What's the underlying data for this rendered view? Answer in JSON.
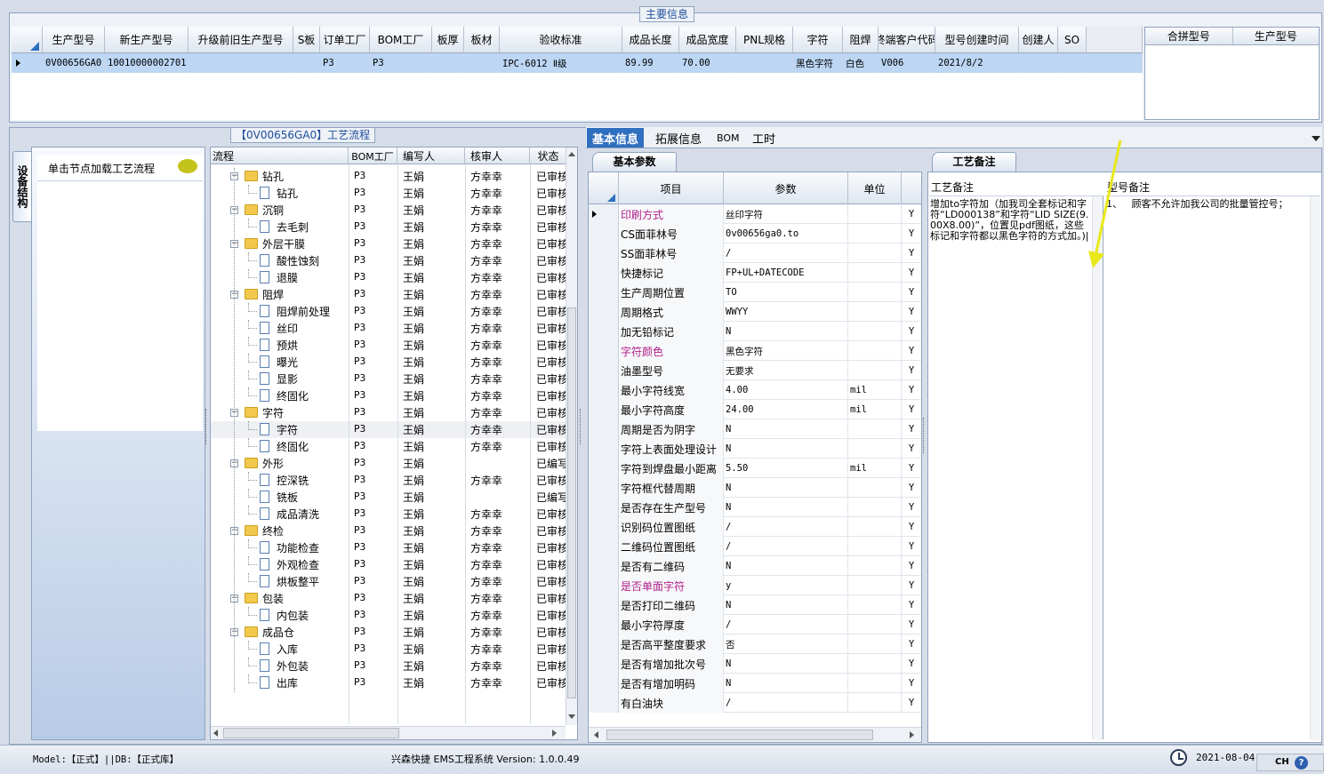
{
  "main_info": {
    "title": "主要信息",
    "columns": [
      "生产型号",
      "新生产型号",
      "升级前旧生产型号",
      "S板",
      "订单工厂",
      "BOM工厂",
      "板厚",
      "板材",
      "验收标准",
      "成品长度",
      "成品宽度",
      "PNL规格",
      "字符",
      "阻焊",
      "终端客户代码",
      "型号创建时间",
      "创建人",
      "SO"
    ],
    "row": [
      "0V00656GA0",
      "10010000002701",
      "",
      "",
      "P3",
      "P3",
      "",
      "",
      "IPC-6012 Ⅱ级",
      "89.99",
      "70.00",
      "",
      "黑色字符",
      "白色",
      "V006",
      "2021/8/2",
      "",
      ""
    ],
    "side_columns": [
      "合拼型号",
      "生产型号"
    ]
  },
  "left_panel": {
    "vertical_tab": "设备结构",
    "hint": "单击节点加载工艺流程"
  },
  "flow": {
    "title": "【0V00656GA0】工艺流程",
    "columns": [
      "流程",
      "BOM工厂",
      "编写人",
      "核审人",
      "状态"
    ],
    "rows": [
      {
        "name": "钻孔",
        "type": "folder",
        "level": 0,
        "bom": "P3",
        "writer": "王娟",
        "reviewer": "方幸幸",
        "status": "已审核"
      },
      {
        "name": "钻孔",
        "type": "doc",
        "level": 1,
        "bom": "P3",
        "writer": "王娟",
        "reviewer": "方幸幸",
        "status": "已审核"
      },
      {
        "name": "沉铜",
        "type": "folder",
        "level": 0,
        "bom": "P3",
        "writer": "王娟",
        "reviewer": "方幸幸",
        "status": "已审核"
      },
      {
        "name": "去毛刺",
        "type": "doc",
        "level": 1,
        "bom": "P3",
        "writer": "王娟",
        "reviewer": "方幸幸",
        "status": "已审核"
      },
      {
        "name": "外层干膜",
        "type": "folder",
        "level": 0,
        "bom": "P3",
        "writer": "王娟",
        "reviewer": "方幸幸",
        "status": "已审核"
      },
      {
        "name": "酸性蚀刻",
        "type": "doc",
        "level": 1,
        "bom": "P3",
        "writer": "王娟",
        "reviewer": "方幸幸",
        "status": "已审核"
      },
      {
        "name": "退膜",
        "type": "doc",
        "level": 1,
        "bom": "P3",
        "writer": "王娟",
        "reviewer": "方幸幸",
        "status": "已审核"
      },
      {
        "name": "阻焊",
        "type": "folder",
        "level": 0,
        "bom": "P3",
        "writer": "王娟",
        "reviewer": "方幸幸",
        "status": "已审核"
      },
      {
        "name": "阻焊前处理",
        "type": "doc",
        "level": 1,
        "bom": "P3",
        "writer": "王娟",
        "reviewer": "方幸幸",
        "status": "已审核"
      },
      {
        "name": "丝印",
        "type": "doc",
        "level": 1,
        "bom": "P3",
        "writer": "王娟",
        "reviewer": "方幸幸",
        "status": "已审核"
      },
      {
        "name": "预烘",
        "type": "doc",
        "level": 1,
        "bom": "P3",
        "writer": "王娟",
        "reviewer": "方幸幸",
        "status": "已审核"
      },
      {
        "name": "曝光",
        "type": "doc",
        "level": 1,
        "bom": "P3",
        "writer": "王娟",
        "reviewer": "方幸幸",
        "status": "已审核"
      },
      {
        "name": "显影",
        "type": "doc",
        "level": 1,
        "bom": "P3",
        "writer": "王娟",
        "reviewer": "方幸幸",
        "status": "已审核"
      },
      {
        "name": "终固化",
        "type": "doc",
        "level": 1,
        "bom": "P3",
        "writer": "王娟",
        "reviewer": "方幸幸",
        "status": "已审核"
      },
      {
        "name": "字符",
        "type": "folder",
        "level": 0,
        "bom": "P3",
        "writer": "王娟",
        "reviewer": "方幸幸",
        "status": "已审核"
      },
      {
        "name": "字符",
        "type": "doc",
        "level": 1,
        "bom": "P3",
        "writer": "王娟",
        "reviewer": "方幸幸",
        "status": "已审核",
        "selected": true
      },
      {
        "name": "终固化",
        "type": "doc",
        "level": 1,
        "bom": "P3",
        "writer": "王娟",
        "reviewer": "方幸幸",
        "status": "已审核"
      },
      {
        "name": "外形",
        "type": "folder",
        "level": 0,
        "bom": "P3",
        "writer": "王娟",
        "reviewer": "",
        "status": "已编写"
      },
      {
        "name": "控深铣",
        "type": "doc",
        "level": 1,
        "bom": "P3",
        "writer": "王娟",
        "reviewer": "方幸幸",
        "status": "已审核"
      },
      {
        "name": "铣板",
        "type": "doc",
        "level": 1,
        "bom": "P3",
        "writer": "王娟",
        "reviewer": "",
        "status": "已编写"
      },
      {
        "name": "成品清洗",
        "type": "doc",
        "level": 1,
        "bom": "P3",
        "writer": "王娟",
        "reviewer": "方幸幸",
        "status": "已审核"
      },
      {
        "name": "终检",
        "type": "folder",
        "level": 0,
        "bom": "P3",
        "writer": "王娟",
        "reviewer": "方幸幸",
        "status": "已审核"
      },
      {
        "name": "功能检查",
        "type": "doc",
        "level": 1,
        "bom": "P3",
        "writer": "王娟",
        "reviewer": "方幸幸",
        "status": "已审核"
      },
      {
        "name": "外观检查",
        "type": "doc",
        "level": 1,
        "bom": "P3",
        "writer": "王娟",
        "reviewer": "方幸幸",
        "status": "已审核"
      },
      {
        "name": "烘板整平",
        "type": "doc",
        "level": 1,
        "bom": "P3",
        "writer": "王娟",
        "reviewer": "方幸幸",
        "status": "已审核"
      },
      {
        "name": "包装",
        "type": "folder",
        "level": 0,
        "bom": "P3",
        "writer": "王娟",
        "reviewer": "方幸幸",
        "status": "已审核"
      },
      {
        "name": "内包装",
        "type": "doc",
        "level": 1,
        "bom": "P3",
        "writer": "王娟",
        "reviewer": "方幸幸",
        "status": "已审核"
      },
      {
        "name": "成品仓",
        "type": "folder",
        "level": 0,
        "bom": "P3",
        "writer": "王娟",
        "reviewer": "方幸幸",
        "status": "已审核"
      },
      {
        "name": "入库",
        "type": "doc",
        "level": 1,
        "bom": "P3",
        "writer": "王娟",
        "reviewer": "方幸幸",
        "status": "已审核"
      },
      {
        "name": "外包装",
        "type": "doc",
        "level": 1,
        "bom": "P3",
        "writer": "王娟",
        "reviewer": "方幸幸",
        "status": "已审核"
      },
      {
        "name": "出库",
        "type": "doc",
        "level": 1,
        "bom": "P3",
        "writer": "王娟",
        "reviewer": "方幸幸",
        "status": "已审核"
      }
    ]
  },
  "detail_tabs": [
    "基本信息",
    "拓展信息",
    "BOM",
    "工时"
  ],
  "basic_params": {
    "tab": "基本参数",
    "columns": [
      "项目",
      "参数",
      "单位"
    ],
    "rows": [
      {
        "item": "印刷方式",
        "value": "丝印字符",
        "unit": "",
        "flag": "Y",
        "highlight": true
      },
      {
        "item": "CS面菲林号",
        "value": "0v00656ga0.to",
        "unit": "",
        "flag": "Y"
      },
      {
        "item": "SS面菲林号",
        "value": "/",
        "unit": "",
        "flag": "Y"
      },
      {
        "item": "快捷标记",
        "value": "FP+UL+DATECODE",
        "unit": "",
        "flag": "Y"
      },
      {
        "item": "生产周期位置",
        "value": "TO",
        "unit": "",
        "flag": "Y"
      },
      {
        "item": "周期格式",
        "value": "WWYY",
        "unit": "",
        "flag": "Y"
      },
      {
        "item": "加无铅标记",
        "value": "N",
        "unit": "",
        "flag": "Y"
      },
      {
        "item": "字符颜色",
        "value": "黑色字符",
        "unit": "",
        "flag": "Y",
        "highlight": true
      },
      {
        "item": "油墨型号",
        "value": "无要求",
        "unit": "",
        "flag": "Y"
      },
      {
        "item": "最小字符线宽",
        "value": "4.00",
        "unit": "mil",
        "flag": "Y"
      },
      {
        "item": "最小字符高度",
        "value": "24.00",
        "unit": "mil",
        "flag": "Y"
      },
      {
        "item": "周期是否为阴字",
        "value": "N",
        "unit": "",
        "flag": "Y"
      },
      {
        "item": "字符上表面处理设计",
        "value": "N",
        "unit": "",
        "flag": "Y"
      },
      {
        "item": "字符到焊盘最小距离",
        "value": "5.50",
        "unit": "mil",
        "flag": "Y"
      },
      {
        "item": "字符框代替周期",
        "value": "N",
        "unit": "",
        "flag": "Y"
      },
      {
        "item": "是否存在生产型号",
        "value": "N",
        "unit": "",
        "flag": "Y"
      },
      {
        "item": "识别码位置图纸",
        "value": "/",
        "unit": "",
        "flag": "Y"
      },
      {
        "item": "二维码位置图纸",
        "value": "/",
        "unit": "",
        "flag": "Y"
      },
      {
        "item": "是否有二维码",
        "value": "N",
        "unit": "",
        "flag": "Y"
      },
      {
        "item": "是否单面字符",
        "value": "y",
        "unit": "",
        "flag": "Y",
        "highlight": true
      },
      {
        "item": "是否打印二维码",
        "value": "N",
        "unit": "",
        "flag": "Y"
      },
      {
        "item": "最小字符厚度",
        "value": "/",
        "unit": "",
        "flag": "Y"
      },
      {
        "item": "是否高平整度要求",
        "value": "否",
        "unit": "",
        "flag": "Y"
      },
      {
        "item": "是否有增加批次号",
        "value": "N",
        "unit": "",
        "flag": "Y"
      },
      {
        "item": "是否有增加明码",
        "value": "N",
        "unit": "",
        "flag": "Y"
      },
      {
        "item": "有白油块",
        "value": "/",
        "unit": "",
        "flag": "Y"
      }
    ]
  },
  "remarks": {
    "tab": "工艺备注",
    "process_label": "工艺备注",
    "model_label": "型号备注",
    "process_text": "增加to字符加（加我司全套标记和字符“LD000138”和字符“LID SIZE(9.00X8.00)”，位置见pdf图纸，这些标记和字符都以黑色字符的方式加。)|",
    "model_text": "1、   顾客不允许加我公司的批量管控号；"
  },
  "status_bar": {
    "model_db": "Model:【正式】||DB:【正式库】",
    "app": "兴森快捷 EMS工程系统 Version: 1.0.0.49",
    "date": "2021-08-04",
    "ime": "CH"
  },
  "colors": {
    "accent": "#2f6fbf",
    "highlight_text": "#b0208a",
    "selected_row": "#bcd6f4",
    "annotation_arrow": "#e8e81a"
  }
}
